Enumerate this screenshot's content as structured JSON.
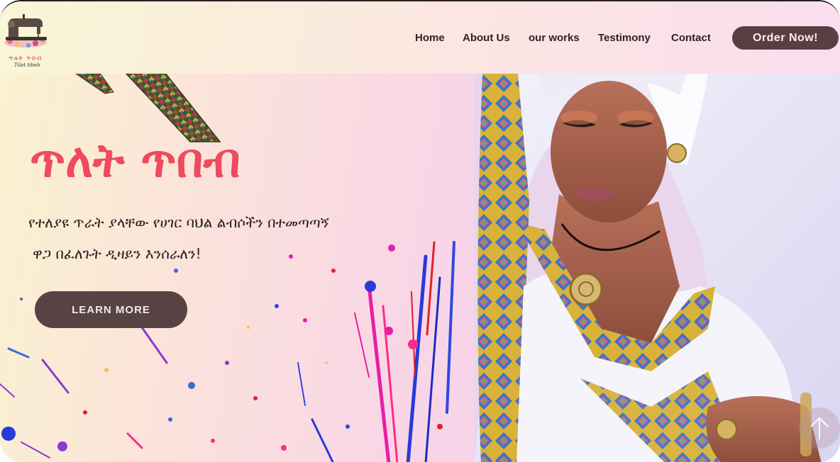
{
  "brand": {
    "logo_text": "ጥለት ጥበብ",
    "logo_subtext": "Tilet tibeb",
    "logo_icon": "sewing-machine-icon"
  },
  "nav": {
    "items": [
      {
        "label": "Home"
      },
      {
        "label": "About Us"
      },
      {
        "label": "our works"
      },
      {
        "label": "Testimony"
      },
      {
        "label": "Contact"
      }
    ],
    "order_label": "Order Now!"
  },
  "hero": {
    "title": "ጥለት ጥበብ",
    "description_line1": "የተለያዩ ጥራት ያላቸው የሀገር ባህል ልብሶችን በተመጣጣኝ",
    "description_line2": "ዋጋ በፈለጉት ዲዛይን እንሰራለን!",
    "button_label": "LEARN MORE"
  },
  "scroll_top": {
    "icon": "arrow-up-icon"
  },
  "colors": {
    "accent": "#ef4a5e",
    "button": "#574343",
    "order_button": "#5a3e44",
    "text": "#2b2222"
  }
}
